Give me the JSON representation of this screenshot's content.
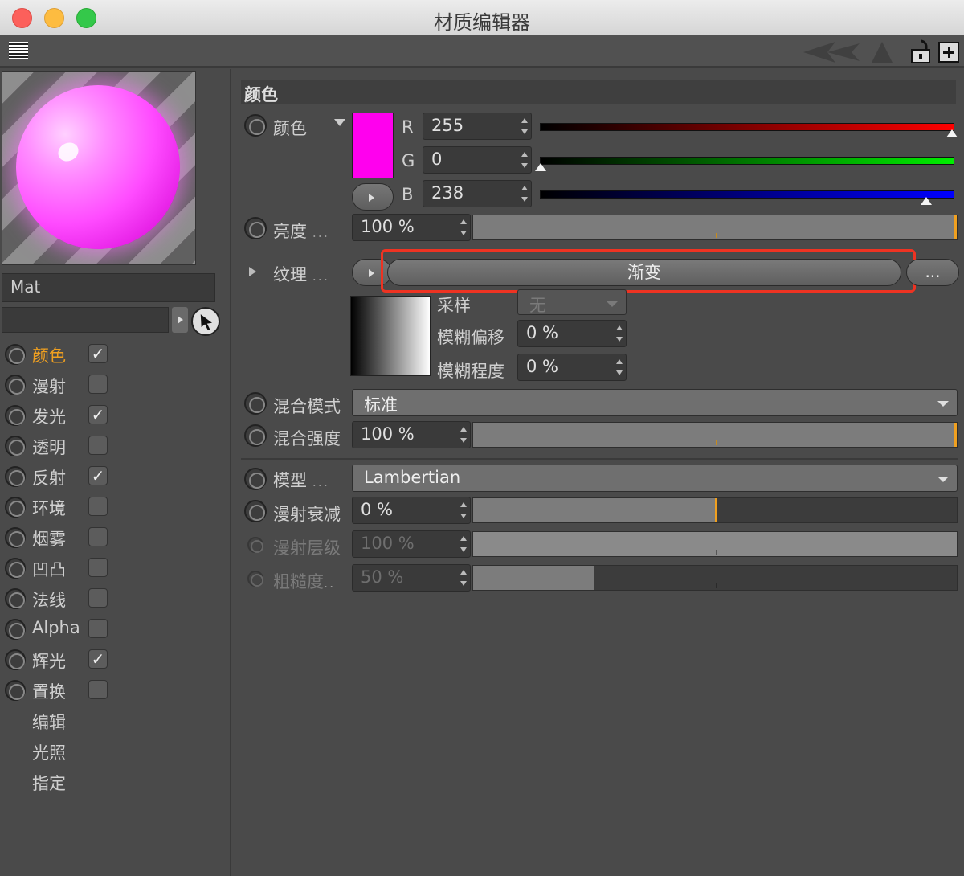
{
  "window": {
    "title": "材质编辑器"
  },
  "material": {
    "name": "Mat",
    "search_value": ""
  },
  "channels": [
    {
      "label": "颜色",
      "checked": true,
      "active": true
    },
    {
      "label": "漫射",
      "checked": false
    },
    {
      "label": "发光",
      "checked": true
    },
    {
      "label": "透明",
      "checked": false
    },
    {
      "label": "反射",
      "checked": true
    },
    {
      "label": "环境",
      "checked": false
    },
    {
      "label": "烟雾",
      "checked": false
    },
    {
      "label": "凹凸",
      "checked": false
    },
    {
      "label": "法线",
      "checked": false
    },
    {
      "label": "Alpha",
      "checked": false
    },
    {
      "label": "辉光",
      "checked": true
    },
    {
      "label": "置换",
      "checked": false
    }
  ],
  "extra_items": [
    "编辑",
    "光照",
    "指定"
  ],
  "color_section": {
    "header": "颜色",
    "color_label": "颜色",
    "swatch_color": "#ff00ee",
    "r_label": "R",
    "r_value": "255",
    "g_label": "G",
    "g_value": "0",
    "b_label": "B",
    "b_value": "238",
    "brightness_label": "亮度",
    "brightness_value": "100 %",
    "texture_label": "纹理",
    "texture_value": "渐变",
    "ellipsis": "...",
    "sampling_label": "采样",
    "sampling_value": "无",
    "blur_offset_label": "模糊偏移",
    "blur_offset_value": "0 %",
    "blur_scale_label": "模糊程度",
    "blur_scale_value": "0 %",
    "mix_mode_label": "混合模式",
    "mix_mode_value": "标准",
    "mix_strength_label": "混合强度",
    "mix_strength_value": "100 %",
    "model_label": "模型",
    "model_value": "Lambertian",
    "diffuse_falloff_label": "漫射衰减",
    "diffuse_falloff_value": "0 %",
    "diffuse_level_label": "漫射层级",
    "diffuse_level_value": "100 %",
    "roughness_label": "粗糙度",
    "roughness_value": "50 %",
    "roughness_fraction": 0.25
  },
  "colors": {
    "accent": "#f0a020",
    "highlight_box": "#ee3322"
  }
}
